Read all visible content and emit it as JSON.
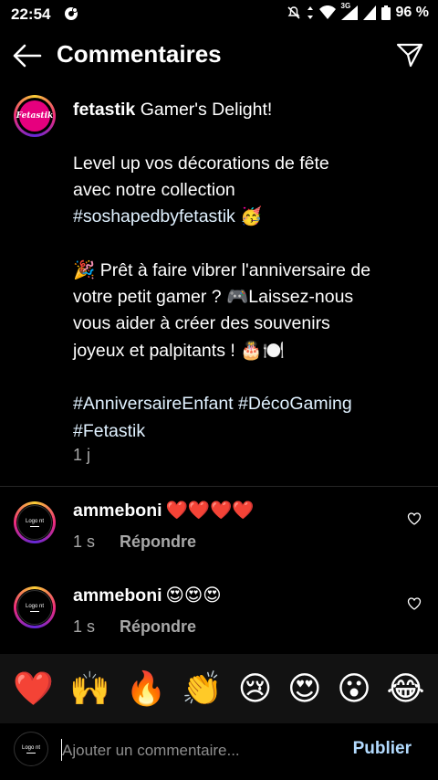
{
  "status": {
    "time": "22:54",
    "network": "3G",
    "battery": "96 %"
  },
  "header": {
    "title": "Commentaires"
  },
  "caption": {
    "username": "fetastik",
    "avatar_text": "Fetastik",
    "line1": " Gamer's Delight!",
    "p2_l1": "Level up vos décorations de fête",
    "p2_l2": "avec notre collection",
    "p2_tag": "#soshapedbyfetastik",
    "p2_emoji": " 🥳",
    "p3_l1": "🎉 Prêt à faire vibrer l'anniversaire de",
    "p3_l2": "votre petit gamer ? 🎮Laissez-nous",
    "p3_l3": "vous aider à créer des souvenirs",
    "p3_l4": "joyeux et palpitants ! 🎂🍽️",
    "tags_l1": "#AnniversaireEnfant #DécoGaming",
    "tags_l2": "#Fetastik",
    "time": "1 j"
  },
  "comments": [
    {
      "username": "ammeboni",
      "text": "❤️❤️❤️❤️",
      "time": "1 s",
      "reply": "Répondre",
      "avatar_text": "Logo nt"
    },
    {
      "username": "ammeboni",
      "text": "😍😍😍",
      "time": "1 s",
      "reply": "Répondre",
      "avatar_text": "Logo nt"
    }
  ],
  "emoji_bar": [
    "❤️",
    "🙌",
    "🔥",
    "👏",
    "😢",
    "😍",
    "😮",
    "😂"
  ],
  "input": {
    "placeholder": "Ajouter un commentaire...",
    "publish": "Publier",
    "avatar_text": "Logo nt"
  },
  "colors": {
    "background": "#000000",
    "hashtag": "#e0f1ff",
    "publish": "#b3dbff",
    "secondary_text": "#a8a8a8"
  }
}
